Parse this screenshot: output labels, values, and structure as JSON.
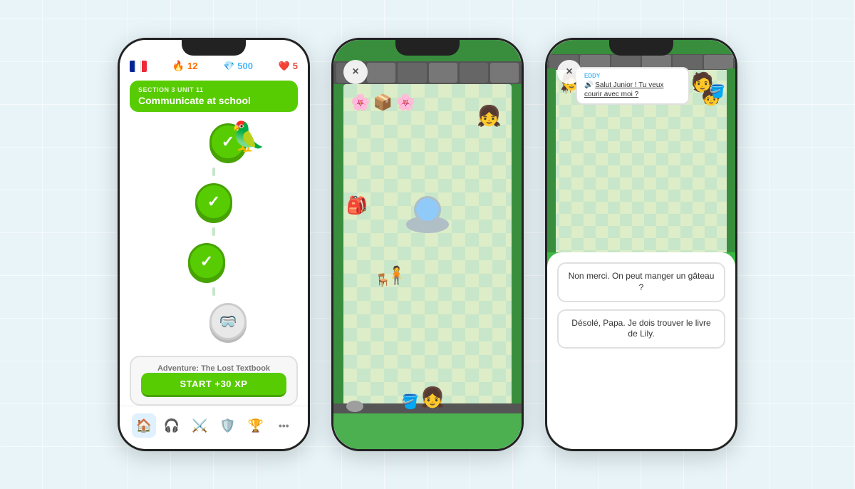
{
  "phone1": {
    "header": {
      "fire_count": "12",
      "gem_count": "500",
      "heart_count": "5"
    },
    "section": {
      "label": "SECTION 3",
      "unit": "UNIT 11",
      "title": "Communicate at school"
    },
    "nodes": [
      {
        "type": "done",
        "id": 1
      },
      {
        "type": "done",
        "id": 2
      },
      {
        "type": "done",
        "id": 3
      },
      {
        "type": "locked",
        "id": 4
      }
    ],
    "adventure": {
      "label": "Adventure: The Lost Textbook",
      "button": "START +30 XP"
    },
    "nav": [
      {
        "icon": "🏠",
        "label": "home",
        "active": true
      },
      {
        "icon": "🎧",
        "label": "listen",
        "active": false
      },
      {
        "icon": "⚔️",
        "label": "battle",
        "active": false
      },
      {
        "icon": "🛡️",
        "label": "shield",
        "active": false
      },
      {
        "icon": "🏆",
        "label": "trophy",
        "active": false
      },
      {
        "icon": "••",
        "label": "more",
        "active": false
      }
    ]
  },
  "phone2": {
    "close_label": "×"
  },
  "phone3": {
    "close_label": "×",
    "speaker_char": "🔊",
    "npc_name": "EDDY",
    "npc_message": "Salut Junior ! Tu veux courir avec moi ?",
    "responses": [
      "Non merci. On peut manger un gâteau ?",
      "Désolé, Papa. Je dois trouver le livre de Lily."
    ]
  }
}
